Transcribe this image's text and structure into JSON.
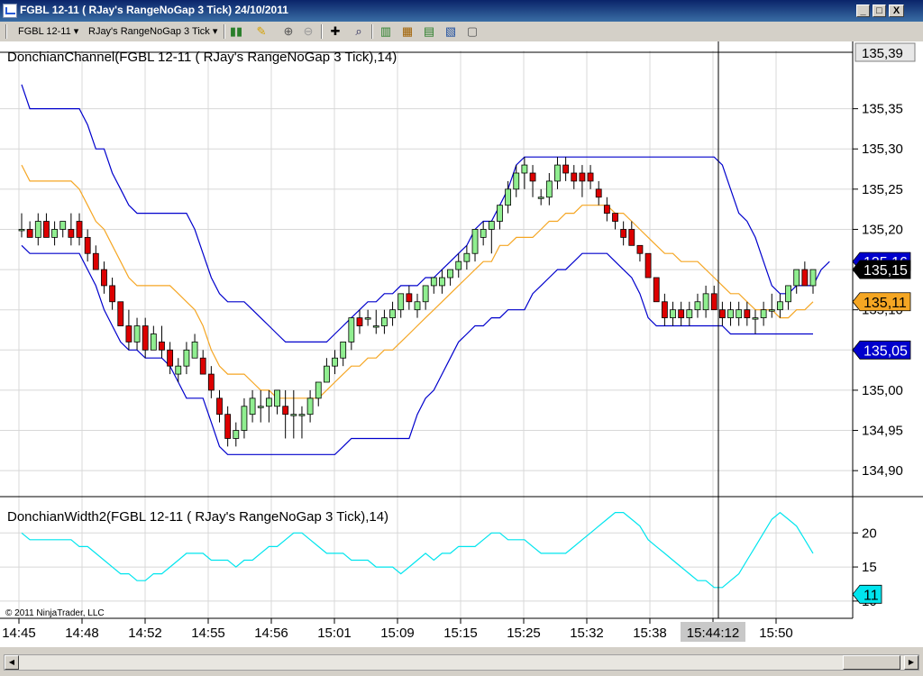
{
  "window": {
    "title": "FGBL 12-11 ( RJay's RangeNoGap  3 Tick)  24/10/2011",
    "controls": {
      "minimize": "_",
      "maximize": "□",
      "close": "X"
    }
  },
  "toolbar": {
    "instrument": "FGBL 12-11",
    "period": "RJay's RangeNoGap  3 Tick",
    "icons": [
      "bar-style-icon",
      "draw-pencil-icon",
      "zoom-in-icon",
      "zoom-out-icon",
      "crosshair-icon",
      "magnifier-icon",
      "strategy-icon",
      "indicators-icon",
      "chart-trader-icon",
      "properties-icon"
    ]
  },
  "colors": {
    "up_candle": "#90ee90",
    "down_candle": "#dd0000",
    "donchian_bands": "#0000cc",
    "donchian_mid": "#f5a623",
    "width_line": "#00e5ee",
    "crosshair": "#000000",
    "price_label_last": "#000000",
    "price_label_blue": "#0000cc",
    "price_label_orange": "#f5a623"
  },
  "chart_data": [
    {
      "type": "candlestick",
      "title": "DonchianChannel(FGBL 12-11 ( RJay's RangeNoGap  3 Tick),14)",
      "x_tick_labels": [
        "14:45",
        "14:48",
        "14:52",
        "14:55",
        "14:56",
        "15:01",
        "15:09",
        "15:15",
        "15:25",
        "15:32",
        "15:38",
        "15:44:12",
        "15:50"
      ],
      "crosshair_label": "15:44:12",
      "y_tick_labels": [
        "135,35",
        "135,30",
        "135,25",
        "135,20",
        "135,15",
        "135,10",
        "135,05",
        "135,00",
        "134,95",
        "134,90"
      ],
      "ylim": [
        134.88,
        135.4
      ],
      "ylim_top_label": "135,39",
      "price_labels": [
        {
          "text": "135,16",
          "value": 135.16,
          "style": "blue"
        },
        {
          "text": "135,15",
          "value": 135.15,
          "style": "last"
        },
        {
          "text": "135,11",
          "value": 135.11,
          "style": "orange"
        },
        {
          "text": "135,05",
          "value": 135.05,
          "style": "blue"
        }
      ],
      "candles": [
        [
          135.2,
          135.22,
          135.19,
          135.2
        ],
        [
          135.2,
          135.21,
          135.19,
          135.19
        ],
        [
          135.19,
          135.22,
          135.18,
          135.21
        ],
        [
          135.21,
          135.22,
          135.19,
          135.19
        ],
        [
          135.19,
          135.21,
          135.18,
          135.2
        ],
        [
          135.2,
          135.21,
          135.19,
          135.21
        ],
        [
          135.2,
          135.22,
          135.18,
          135.19
        ],
        [
          135.21,
          135.22,
          135.18,
          135.19
        ],
        [
          135.19,
          135.2,
          135.16,
          135.17
        ],
        [
          135.17,
          135.18,
          135.15,
          135.15
        ],
        [
          135.15,
          135.16,
          135.12,
          135.13
        ],
        [
          135.13,
          135.14,
          135.1,
          135.11
        ],
        [
          135.11,
          135.11,
          135.08,
          135.08
        ],
        [
          135.08,
          135.1,
          135.05,
          135.06
        ],
        [
          135.06,
          135.09,
          135.05,
          135.08
        ],
        [
          135.08,
          135.09,
          135.04,
          135.05
        ],
        [
          135.05,
          135.08,
          135.05,
          135.07
        ],
        [
          135.06,
          135.08,
          135.04,
          135.05
        ],
        [
          135.05,
          135.06,
          135.02,
          135.03
        ],
        [
          135.02,
          135.04,
          135.01,
          135.03
        ],
        [
          135.03,
          135.06,
          135.02,
          135.05
        ],
        [
          135.04,
          135.07,
          135.04,
          135.06
        ],
        [
          135.04,
          135.05,
          135.02,
          135.02
        ],
        [
          135.02,
          135.03,
          134.99,
          135.0
        ],
        [
          134.99,
          135.0,
          134.96,
          134.97
        ],
        [
          134.97,
          134.98,
          134.93,
          134.94
        ],
        [
          134.94,
          134.96,
          134.93,
          134.95
        ],
        [
          134.95,
          134.99,
          134.94,
          134.98
        ],
        [
          134.97,
          135.0,
          134.96,
          134.99
        ],
        [
          134.98,
          135.0,
          134.96,
          134.98
        ],
        [
          134.98,
          135.0,
          134.96,
          134.99
        ],
        [
          134.98,
          135.0,
          134.97,
          135.0
        ],
        [
          134.98,
          135.0,
          134.94,
          134.97
        ],
        [
          134.97,
          135.0,
          134.94,
          134.97
        ],
        [
          134.97,
          134.98,
          134.94,
          134.97
        ],
        [
          134.97,
          135.0,
          134.96,
          134.99
        ],
        [
          134.99,
          135.01,
          134.98,
          135.01
        ],
        [
          135.01,
          135.04,
          135.01,
          135.03
        ],
        [
          135.03,
          135.05,
          135.02,
          135.04
        ],
        [
          135.04,
          135.06,
          135.03,
          135.06
        ],
        [
          135.06,
          135.09,
          135.05,
          135.09
        ],
        [
          135.09,
          135.1,
          135.07,
          135.08
        ],
        [
          135.09,
          135.1,
          135.08,
          135.09
        ],
        [
          135.08,
          135.1,
          135.07,
          135.08
        ],
        [
          135.08,
          135.1,
          135.07,
          135.09
        ],
        [
          135.09,
          135.11,
          135.08,
          135.1
        ],
        [
          135.1,
          135.12,
          135.09,
          135.12
        ],
        [
          135.12,
          135.13,
          135.1,
          135.11
        ],
        [
          135.1,
          135.12,
          135.09,
          135.11
        ],
        [
          135.11,
          135.13,
          135.1,
          135.13
        ],
        [
          135.13,
          135.14,
          135.12,
          135.14
        ],
        [
          135.13,
          135.15,
          135.12,
          135.14
        ],
        [
          135.14,
          135.15,
          135.13,
          135.15
        ],
        [
          135.15,
          135.17,
          135.14,
          135.16
        ],
        [
          135.16,
          135.18,
          135.15,
          135.17
        ],
        [
          135.17,
          135.2,
          135.16,
          135.2
        ],
        [
          135.19,
          135.21,
          135.18,
          135.2
        ],
        [
          135.2,
          135.21,
          135.17,
          135.21
        ],
        [
          135.21,
          135.23,
          135.2,
          135.23
        ],
        [
          135.23,
          135.26,
          135.22,
          135.25
        ],
        [
          135.25,
          135.28,
          135.24,
          135.27
        ],
        [
          135.27,
          135.29,
          135.25,
          135.28
        ],
        [
          135.27,
          135.28,
          135.24,
          135.26
        ],
        [
          135.24,
          135.25,
          135.23,
          135.24
        ],
        [
          135.24,
          135.27,
          135.23,
          135.26
        ],
        [
          135.26,
          135.29,
          135.25,
          135.28
        ],
        [
          135.28,
          135.29,
          135.26,
          135.27
        ],
        [
          135.27,
          135.28,
          135.25,
          135.26
        ],
        [
          135.27,
          135.28,
          135.24,
          135.26
        ],
        [
          135.27,
          135.28,
          135.25,
          135.26
        ],
        [
          135.25,
          135.26,
          135.23,
          135.24
        ],
        [
          135.23,
          135.24,
          135.21,
          135.22
        ],
        [
          135.22,
          135.22,
          135.2,
          135.21
        ],
        [
          135.2,
          135.21,
          135.18,
          135.19
        ],
        [
          135.2,
          135.21,
          135.18,
          135.18
        ],
        [
          135.18,
          135.18,
          135.16,
          135.17
        ],
        [
          135.17,
          135.17,
          135.14,
          135.14
        ],
        [
          135.14,
          135.14,
          135.11,
          135.11
        ],
        [
          135.11,
          135.12,
          135.08,
          135.09
        ],
        [
          135.09,
          135.11,
          135.08,
          135.1
        ],
        [
          135.1,
          135.11,
          135.08,
          135.09
        ],
        [
          135.09,
          135.11,
          135.08,
          135.1
        ],
        [
          135.1,
          135.12,
          135.09,
          135.11
        ],
        [
          135.1,
          135.13,
          135.09,
          135.12
        ],
        [
          135.12,
          135.13,
          135.1,
          135.1
        ],
        [
          135.1,
          135.11,
          135.08,
          135.09
        ],
        [
          135.09,
          135.11,
          135.08,
          135.1
        ],
        [
          135.09,
          135.11,
          135.08,
          135.1
        ],
        [
          135.1,
          135.11,
          135.08,
          135.09
        ],
        [
          135.09,
          135.1,
          135.07,
          135.09
        ],
        [
          135.09,
          135.11,
          135.08,
          135.1
        ],
        [
          135.1,
          135.12,
          135.09,
          135.1
        ],
        [
          135.1,
          135.12,
          135.09,
          135.11
        ],
        [
          135.11,
          135.13,
          135.1,
          135.13
        ],
        [
          135.13,
          135.15,
          135.12,
          135.15
        ],
        [
          135.15,
          135.16,
          135.13,
          135.13
        ],
        [
          135.13,
          135.15,
          135.12,
          135.15
        ]
      ],
      "series": [
        {
          "name": "upper",
          "style": "donchian_bands",
          "values": [
            135.38,
            135.35,
            135.35,
            135.35,
            135.35,
            135.35,
            135.35,
            135.35,
            135.33,
            135.3,
            135.3,
            135.27,
            135.25,
            135.23,
            135.22,
            135.22,
            135.22,
            135.22,
            135.22,
            135.22,
            135.22,
            135.2,
            135.17,
            135.14,
            135.12,
            135.11,
            135.11,
            135.11,
            135.1,
            135.09,
            135.08,
            135.07,
            135.06,
            135.06,
            135.06,
            135.06,
            135.06,
            135.06,
            135.07,
            135.08,
            135.09,
            135.1,
            135.11,
            135.11,
            135.12,
            135.12,
            135.13,
            135.13,
            135.13,
            135.14,
            135.14,
            135.15,
            135.16,
            135.17,
            135.18,
            135.2,
            135.21,
            135.21,
            135.23,
            135.25,
            135.28,
            135.29,
            135.29,
            135.29,
            135.29,
            135.29,
            135.29,
            135.29,
            135.29,
            135.29,
            135.29,
            135.29,
            135.29,
            135.29,
            135.29,
            135.29,
            135.29,
            135.29,
            135.29,
            135.29,
            135.29,
            135.29,
            135.29,
            135.29,
            135.29,
            135.28,
            135.25,
            135.22,
            135.21,
            135.19,
            135.16,
            135.13,
            135.12,
            135.12,
            135.13,
            135.13,
            135.13,
            135.15,
            135.16
          ]
        },
        {
          "name": "middle",
          "style": "donchian_mid",
          "values": [
            135.28,
            135.26,
            135.26,
            135.26,
            135.26,
            135.26,
            135.26,
            135.25,
            135.23,
            135.21,
            135.2,
            135.18,
            135.16,
            135.14,
            135.13,
            135.13,
            135.13,
            135.13,
            135.13,
            135.12,
            135.11,
            135.1,
            135.08,
            135.05,
            135.03,
            135.02,
            135.02,
            135.02,
            135.01,
            135.0,
            135.0,
            134.99,
            134.99,
            134.99,
            134.99,
            134.99,
            134.99,
            135.0,
            135.01,
            135.02,
            135.03,
            135.03,
            135.04,
            135.04,
            135.05,
            135.05,
            135.06,
            135.07,
            135.08,
            135.09,
            135.1,
            135.11,
            135.12,
            135.13,
            135.14,
            135.15,
            135.16,
            135.16,
            135.18,
            135.18,
            135.19,
            135.19,
            135.19,
            135.2,
            135.21,
            135.21,
            135.22,
            135.22,
            135.23,
            135.23,
            135.23,
            135.23,
            135.22,
            135.22,
            135.21,
            135.2,
            135.19,
            135.18,
            135.17,
            135.17,
            135.16,
            135.16,
            135.16,
            135.15,
            135.14,
            135.13,
            135.12,
            135.12,
            135.11,
            135.1,
            135.1,
            135.1,
            135.09,
            135.09,
            135.1,
            135.1,
            135.11
          ]
        },
        {
          "name": "lower",
          "style": "donchian_bands",
          "values": [
            135.18,
            135.17,
            135.17,
            135.17,
            135.17,
            135.17,
            135.17,
            135.17,
            135.15,
            135.13,
            135.1,
            135.08,
            135.06,
            135.05,
            135.05,
            135.04,
            135.04,
            135.04,
            135.03,
            135.01,
            134.99,
            134.99,
            134.99,
            134.96,
            134.93,
            134.92,
            134.92,
            134.92,
            134.92,
            134.92,
            134.92,
            134.92,
            134.92,
            134.92,
            134.92,
            134.92,
            134.92,
            134.92,
            134.92,
            134.93,
            134.94,
            134.94,
            134.94,
            134.94,
            134.94,
            134.94,
            134.94,
            134.94,
            134.97,
            134.99,
            135.0,
            135.02,
            135.04,
            135.06,
            135.07,
            135.08,
            135.08,
            135.09,
            135.09,
            135.1,
            135.1,
            135.1,
            135.12,
            135.13,
            135.14,
            135.15,
            135.15,
            135.16,
            135.17,
            135.17,
            135.17,
            135.17,
            135.16,
            135.15,
            135.14,
            135.12,
            135.09,
            135.08,
            135.08,
            135.08,
            135.08,
            135.08,
            135.08,
            135.08,
            135.08,
            135.08,
            135.07,
            135.07,
            135.07,
            135.07,
            135.07,
            135.07,
            135.07,
            135.07,
            135.07,
            135.07,
            135.07
          ]
        }
      ]
    },
    {
      "type": "line",
      "title": "DonchianWidth2(FGBL 12-11 ( RJay's RangeNoGap  3 Tick),14)",
      "y_tick_labels": [
        "20",
        "15",
        "10"
      ],
      "ylim": [
        8,
        24
      ],
      "price_labels": [
        {
          "text": "11",
          "value": 11,
          "style": "cyan"
        }
      ],
      "series": [
        {
          "name": "width",
          "style": "width_line",
          "values": [
            20,
            19,
            19,
            19,
            19,
            19,
            19,
            18,
            18,
            17,
            16,
            15,
            14,
            14,
            13,
            13,
            14,
            14,
            15,
            16,
            17,
            17,
            17,
            16,
            16,
            16,
            15,
            16,
            16,
            17,
            18,
            18,
            19,
            20,
            20,
            19,
            18,
            17,
            17,
            17,
            16,
            16,
            16,
            15,
            15,
            15,
            14,
            15,
            16,
            17,
            16,
            17,
            17,
            18,
            18,
            18,
            19,
            20,
            20,
            19,
            19,
            19,
            18,
            17,
            17,
            17,
            17,
            18,
            19,
            20,
            21,
            22,
            23,
            23,
            22,
            21,
            19,
            18,
            17,
            16,
            15,
            14,
            13,
            13,
            12,
            12,
            13,
            14,
            16,
            18,
            20,
            22,
            23,
            22,
            21,
            19,
            17
          ]
        }
      ]
    }
  ],
  "copyright": "© 2011 NinjaTrader, LLC"
}
